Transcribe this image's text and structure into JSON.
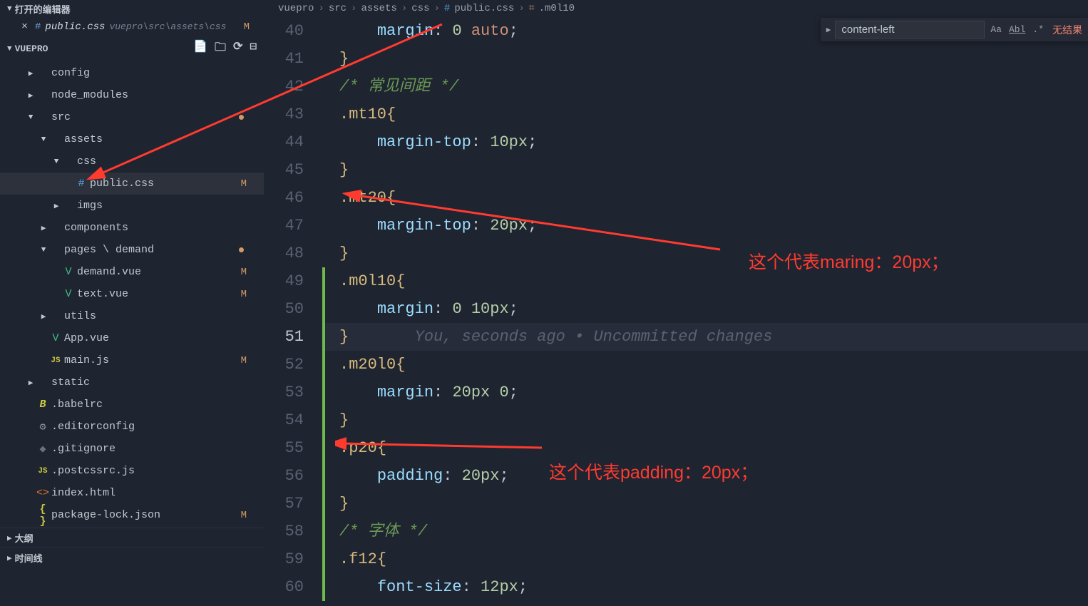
{
  "sidebar": {
    "openEditorsTitle": "打开的编辑器",
    "openTab": {
      "filename": "public.css",
      "path": "vuepro\\src\\assets\\css",
      "gitStatus": "M"
    },
    "projectTitle": "VUEPRO",
    "tree": [
      {
        "indent": 1,
        "chev": ">",
        "icon": "",
        "label": "config",
        "type": "folder"
      },
      {
        "indent": 1,
        "chev": ">",
        "icon": "",
        "label": "node_modules",
        "type": "folder"
      },
      {
        "indent": 1,
        "chev": "v",
        "icon": "",
        "label": "src",
        "type": "folder",
        "dot": true
      },
      {
        "indent": 2,
        "chev": "v",
        "icon": "",
        "label": "assets",
        "type": "folder"
      },
      {
        "indent": 3,
        "chev": "v",
        "icon": "",
        "label": "css",
        "type": "folder"
      },
      {
        "indent": 4,
        "chev": "",
        "icon": "#",
        "label": "public.css",
        "type": "css",
        "gstat": "M",
        "selected": true
      },
      {
        "indent": 3,
        "chev": ">",
        "icon": "",
        "label": "imgs",
        "type": "folder"
      },
      {
        "indent": 2,
        "chev": ">",
        "icon": "",
        "label": "components",
        "type": "folder"
      },
      {
        "indent": 2,
        "chev": "v",
        "icon": "",
        "label": "pages \\ demand",
        "type": "folder",
        "dot": true
      },
      {
        "indent": 3,
        "chev": "",
        "icon": "V",
        "label": "demand.vue",
        "type": "vue",
        "gstat": "M"
      },
      {
        "indent": 3,
        "chev": "",
        "icon": "V",
        "label": "text.vue",
        "type": "vue",
        "gstat": "M"
      },
      {
        "indent": 2,
        "chev": ">",
        "icon": "",
        "label": "utils",
        "type": "folder"
      },
      {
        "indent": 2,
        "chev": "",
        "icon": "V",
        "label": "App.vue",
        "type": "vue"
      },
      {
        "indent": 2,
        "chev": "",
        "icon": "JS",
        "label": "main.js",
        "type": "js",
        "gstat": "M"
      },
      {
        "indent": 1,
        "chev": ">",
        "icon": "",
        "label": "static",
        "type": "folder"
      },
      {
        "indent": 1,
        "chev": "",
        "icon": "B",
        "label": ".babelrc",
        "type": "babel"
      },
      {
        "indent": 1,
        "chev": "",
        "icon": "⚙",
        "label": ".editorconfig",
        "type": "gear"
      },
      {
        "indent": 1,
        "chev": "",
        "icon": "◆",
        "label": ".gitignore",
        "type": "git"
      },
      {
        "indent": 1,
        "chev": "",
        "icon": "JS",
        "label": ".postcssrc.js",
        "type": "js"
      },
      {
        "indent": 1,
        "chev": "",
        "icon": "<>",
        "label": "index.html",
        "type": "html"
      },
      {
        "indent": 1,
        "chev": "",
        "icon": "{ }",
        "label": "package-lock.json",
        "type": "json",
        "gstat": "M"
      }
    ],
    "footer": [
      "大纲",
      "时间线"
    ]
  },
  "breadcrumbs": [
    "vuepro",
    "src",
    "assets",
    "css",
    "public.css",
    ".m0l10"
  ],
  "editor": {
    "startLine": 40,
    "currentLine": 51,
    "changeBarStart": 49,
    "changeBarEnd": 60,
    "lines": [
      {
        "n": 40,
        "tokens": [
          {
            "t": "    ",
            "c": ""
          },
          {
            "t": "margin",
            "c": "c-prop"
          },
          {
            "t": ": ",
            "c": "c-punct"
          },
          {
            "t": "0",
            "c": "c-num"
          },
          {
            "t": " ",
            "c": ""
          },
          {
            "t": "auto",
            "c": "c-val"
          },
          {
            "t": ";",
            "c": "c-punct"
          }
        ]
      },
      {
        "n": 41,
        "tokens": [
          {
            "t": "}",
            "c": "c-brace"
          }
        ]
      },
      {
        "n": 42,
        "tokens": [
          {
            "t": "/* 常见间距 */",
            "c": "c-comment"
          }
        ]
      },
      {
        "n": 43,
        "tokens": [
          {
            "t": ".mt10",
            "c": "c-selector"
          },
          {
            "t": "{",
            "c": "c-brace"
          }
        ]
      },
      {
        "n": 44,
        "tokens": [
          {
            "t": "    ",
            "c": ""
          },
          {
            "t": "margin-top",
            "c": "c-prop"
          },
          {
            "t": ": ",
            "c": "c-punct"
          },
          {
            "t": "10px",
            "c": "c-num"
          },
          {
            "t": ";",
            "c": "c-punct"
          }
        ]
      },
      {
        "n": 45,
        "tokens": [
          {
            "t": "}",
            "c": "c-brace"
          }
        ]
      },
      {
        "n": 46,
        "tokens": [
          {
            "t": ".mt20",
            "c": "c-selector"
          },
          {
            "t": "{",
            "c": "c-brace"
          }
        ]
      },
      {
        "n": 47,
        "tokens": [
          {
            "t": "    ",
            "c": ""
          },
          {
            "t": "margin-top",
            "c": "c-prop"
          },
          {
            "t": ": ",
            "c": "c-punct"
          },
          {
            "t": "20px",
            "c": "c-num"
          },
          {
            "t": ";",
            "c": "c-punct"
          }
        ]
      },
      {
        "n": 48,
        "tokens": [
          {
            "t": "}",
            "c": "c-brace"
          }
        ]
      },
      {
        "n": 49,
        "tokens": [
          {
            "t": ".m0l10",
            "c": "c-selector"
          },
          {
            "t": "{",
            "c": "c-brace"
          }
        ]
      },
      {
        "n": 50,
        "tokens": [
          {
            "t": "    ",
            "c": ""
          },
          {
            "t": "margin",
            "c": "c-prop"
          },
          {
            "t": ": ",
            "c": "c-punct"
          },
          {
            "t": "0",
            "c": "c-num"
          },
          {
            "t": " ",
            "c": ""
          },
          {
            "t": "10px",
            "c": "c-num"
          },
          {
            "t": ";",
            "c": "c-punct"
          }
        ]
      },
      {
        "n": 51,
        "tokens": [
          {
            "t": "}",
            "c": "c-brace"
          },
          {
            "t": "       You, seconds ago • Uncommitted changes",
            "c": "c-inline-hint"
          }
        ],
        "current": true
      },
      {
        "n": 52,
        "tokens": [
          {
            "t": ".m20l0",
            "c": "c-selector"
          },
          {
            "t": "{",
            "c": "c-brace"
          }
        ]
      },
      {
        "n": 53,
        "tokens": [
          {
            "t": "    ",
            "c": ""
          },
          {
            "t": "margin",
            "c": "c-prop"
          },
          {
            "t": ": ",
            "c": "c-punct"
          },
          {
            "t": "20px",
            "c": "c-num"
          },
          {
            "t": " ",
            "c": ""
          },
          {
            "t": "0",
            "c": "c-num"
          },
          {
            "t": ";",
            "c": "c-punct"
          }
        ]
      },
      {
        "n": 54,
        "tokens": [
          {
            "t": "}",
            "c": "c-brace"
          }
        ]
      },
      {
        "n": 55,
        "tokens": [
          {
            "t": ".p20",
            "c": "c-selector"
          },
          {
            "t": "{",
            "c": "c-brace"
          }
        ]
      },
      {
        "n": 56,
        "tokens": [
          {
            "t": "    ",
            "c": ""
          },
          {
            "t": "padding",
            "c": "c-prop"
          },
          {
            "t": ": ",
            "c": "c-punct"
          },
          {
            "t": "20px",
            "c": "c-num"
          },
          {
            "t": ";",
            "c": "c-punct"
          }
        ]
      },
      {
        "n": 57,
        "tokens": [
          {
            "t": "}",
            "c": "c-brace"
          }
        ]
      },
      {
        "n": 58,
        "tokens": [
          {
            "t": "/* 字体 */",
            "c": "c-comment"
          }
        ]
      },
      {
        "n": 59,
        "tokens": [
          {
            "t": ".f12",
            "c": "c-selector"
          },
          {
            "t": "{",
            "c": "c-brace"
          }
        ]
      },
      {
        "n": 60,
        "tokens": [
          {
            "t": "    ",
            "c": ""
          },
          {
            "t": "font-size",
            "c": "c-prop"
          },
          {
            "t": ": ",
            "c": "c-punct"
          },
          {
            "t": "12px",
            "c": "c-num"
          },
          {
            "t": ";",
            "c": "c-punct"
          }
        ]
      }
    ]
  },
  "find": {
    "value": "content-left",
    "noResult": "无结果",
    "optCase": "Aa",
    "optWord": "Abl",
    "optRegex": ".*"
  },
  "annotations": {
    "a1": "这个代表maring：20px；",
    "a2": "这个代表padding：20px；"
  }
}
